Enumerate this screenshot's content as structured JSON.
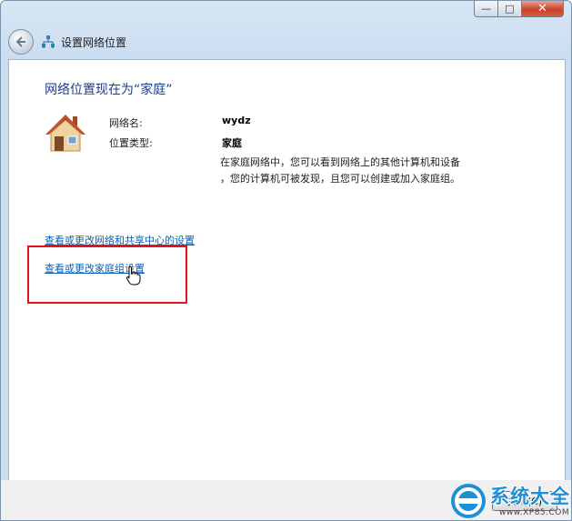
{
  "window": {
    "caption_buttons": {
      "minimize": "—",
      "maximize": "□",
      "close": "✕"
    },
    "nav_title": "设置网络位置"
  },
  "main": {
    "heading": "网络位置现在为“家庭”",
    "network_name_label": "网络名:",
    "network_name_value": "wydz",
    "location_type_label": "位置类型:",
    "location_type_value": "家庭",
    "description_line1": "在家庭网络中，您可以看到网络上的其他计算机和设备",
    "description_line2": "，您的计算机可被发现，且您可以创建或加入家庭组。",
    "link_network_center": "查看或更改网络和共享中心的设置",
    "link_homegroup": "查看或更改家庭组设置"
  },
  "footer": {
    "finish_button": "关闭(C)"
  },
  "watermark": {
    "logo_text": "系统大全",
    "url": "www.XP85.COM"
  },
  "colors": {
    "heading": "#1e3b8c",
    "link": "#0b5fb5",
    "highlight": "#e0141c"
  }
}
